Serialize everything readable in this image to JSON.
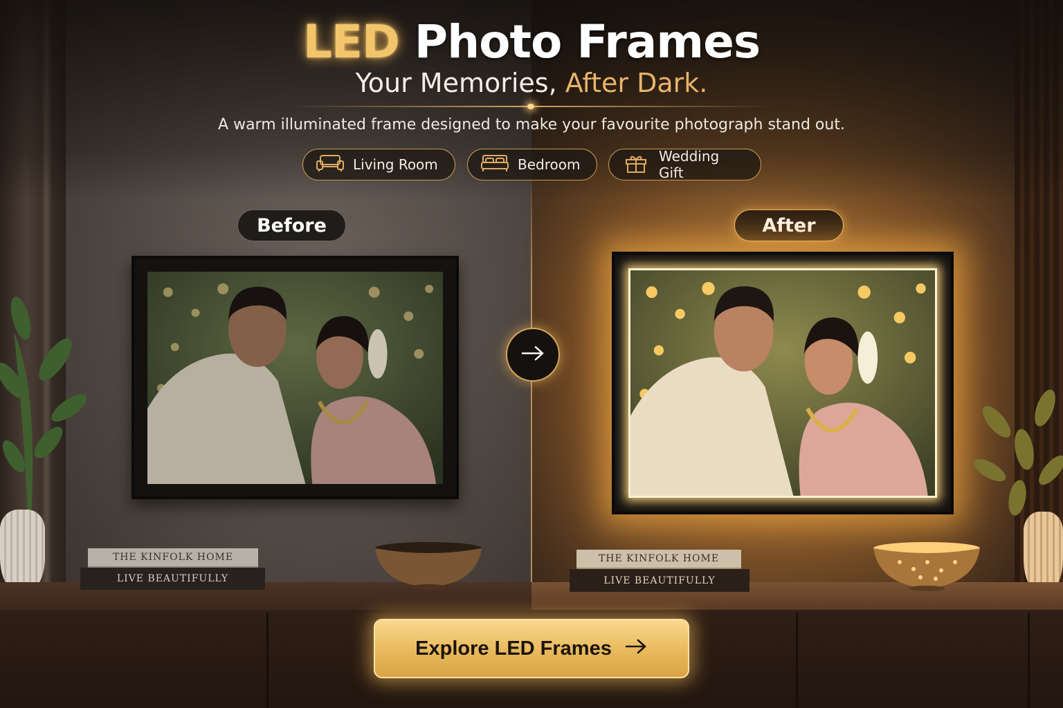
{
  "header": {
    "title_highlight": "LED",
    "title_rest": "Photo Frames",
    "subtitle_main": "Your Memories,",
    "subtitle_accent": "After Dark.",
    "tagline": "A warm illuminated frame designed to make your favourite photograph stand out."
  },
  "chips": [
    {
      "label": "Living Room",
      "icon": "sofa-icon"
    },
    {
      "label": "Bedroom",
      "icon": "bed-icon"
    },
    {
      "label": "Wedding Gift",
      "icon": "gift-icon"
    }
  ],
  "comparison": {
    "before_label": "Before",
    "after_label": "After",
    "arrow_icon": "arrow-right-icon"
  },
  "books": {
    "top_title": "THE KINFOLK HOME",
    "bottom_title": "LIVE BEAUTIFULLY"
  },
  "cta": {
    "label": "Explore LED Frames",
    "icon": "arrow-right-icon"
  },
  "colors": {
    "accent_gold": "#e9b46a",
    "cta_gold": "#e8b95c",
    "text_white": "#ffffff"
  }
}
